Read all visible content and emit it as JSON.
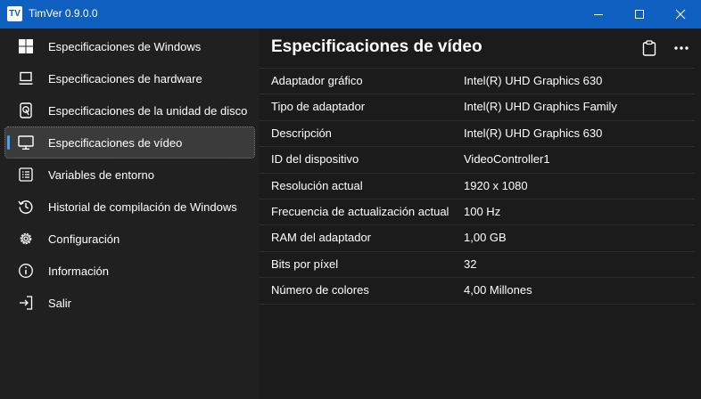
{
  "window": {
    "app_icon_text": "TV",
    "title": "TimVer  0.9.0.0",
    "accent_color": "#0f5fc0"
  },
  "sidebar": {
    "items": [
      {
        "label": "Especificaciones de Windows",
        "icon": "windows-logo-icon",
        "selected": false
      },
      {
        "label": "Especificaciones de hardware",
        "icon": "laptop-icon",
        "selected": false
      },
      {
        "label": "Especificaciones de la unidad de disco",
        "icon": "disk-drive-icon",
        "selected": false
      },
      {
        "label": "Especificaciones de vídeo",
        "icon": "monitor-icon",
        "selected": true
      },
      {
        "label": "Variables de entorno",
        "icon": "list-icon",
        "selected": false
      },
      {
        "label": "Historial de compilación de Windows",
        "icon": "history-icon",
        "selected": false
      },
      {
        "label": "Configuración",
        "icon": "gear-icon",
        "selected": false
      },
      {
        "label": "Información",
        "icon": "info-icon",
        "selected": false
      },
      {
        "label": "Salir",
        "icon": "exit-icon",
        "selected": false
      }
    ],
    "indicator_color": "#4aa0f0"
  },
  "main": {
    "title": "Especificaciones de vídeo",
    "rows": [
      {
        "key": "Adaptador gráfico",
        "value": "Intel(R) UHD Graphics 630"
      },
      {
        "key": "Tipo de adaptador",
        "value": "Intel(R) UHD Graphics Family"
      },
      {
        "key": "Descripción",
        "value": "Intel(R) UHD Graphics 630"
      },
      {
        "key": "ID del dispositivo",
        "value": "VideoController1"
      },
      {
        "key": "Resolución actual",
        "value": "1920 x 1080"
      },
      {
        "key": "Frecuencia de actualización actual",
        "value": "100 Hz"
      },
      {
        "key": "RAM del adaptador",
        "value": "1,00 GB"
      },
      {
        "key": "Bits por píxel",
        "value": "32"
      },
      {
        "key": "Número de colores",
        "value": "4,00 Millones"
      }
    ]
  }
}
